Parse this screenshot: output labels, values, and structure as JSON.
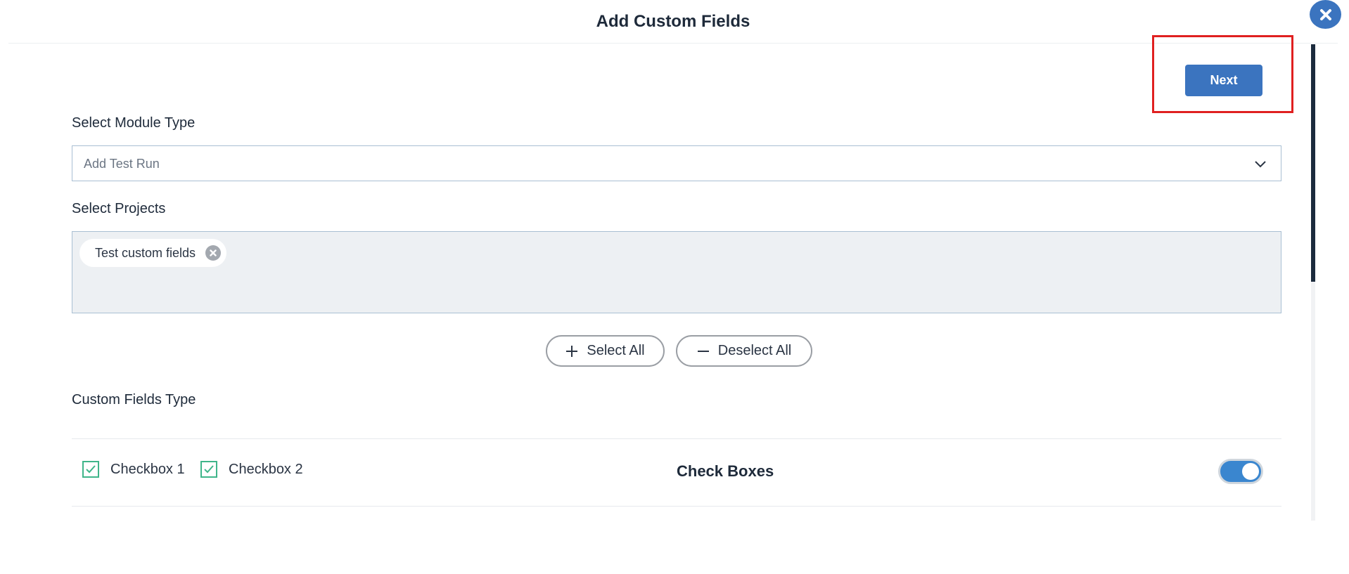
{
  "dialog": {
    "title": "Add Custom Fields",
    "close_icon": "close-x-icon"
  },
  "toolbar": {
    "next_label": "Next"
  },
  "module_type": {
    "label": "Select Module Type",
    "selected_value": "Add Test Run",
    "chevron_icon": "chevron-down-icon"
  },
  "projects": {
    "label": "Select Projects",
    "selected": [
      {
        "name": "Test custom fields",
        "remove_icon": "remove-circle-icon"
      }
    ],
    "select_all_label": "Select All",
    "deselect_all_label": "Deselect All"
  },
  "custom_fields": {
    "label": "Custom Fields Type",
    "rows": [
      {
        "options": [
          {
            "label": "Checkbox 1",
            "checked": true
          },
          {
            "label": "Checkbox 2",
            "checked": true
          }
        ],
        "type_name": "Check Boxes",
        "enabled": true
      }
    ]
  },
  "colors": {
    "primary": "#3b74bf",
    "highlight": "#e02020",
    "check": "#3fb58a",
    "toggle_on": "#3a86cf"
  }
}
